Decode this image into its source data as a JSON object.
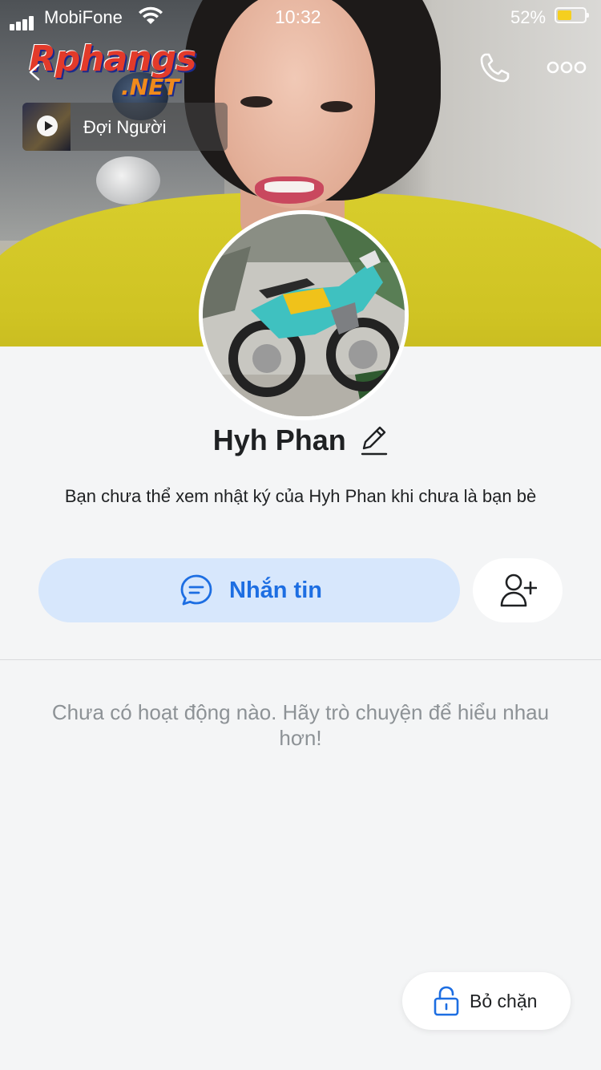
{
  "status_bar": {
    "carrier": "MobiFone",
    "time": "10:32",
    "battery_percent": "52%",
    "battery_level": 0.52,
    "signal_bars": 4
  },
  "watermark": {
    "main": "Rphangs",
    "sub": ".NET"
  },
  "header": {
    "icons": [
      "back-icon",
      "phone-icon",
      "more-icon"
    ]
  },
  "music": {
    "title": "Đợi Người"
  },
  "profile": {
    "name": "Hyh Phan",
    "notice": "Bạn chưa thể xem nhật ký của Hyh Phan khi chưa là bạn bè"
  },
  "actions": {
    "message_label": "Nhắn tin",
    "message_icon": "chat-icon",
    "add_friend_icon": "add-friend-icon"
  },
  "activity": {
    "empty_text": "Chưa có hoạt động nào. Hãy trò chuyện để hiểu nhau hơn!"
  },
  "unblock": {
    "label": "Bỏ chặn",
    "icon": "unlock-icon"
  },
  "colors": {
    "accent": "#1d6ee2",
    "accent_bg": "#d7e7fc",
    "page_bg": "#f4f5f6",
    "battery_fill": "#f5cf1f"
  }
}
